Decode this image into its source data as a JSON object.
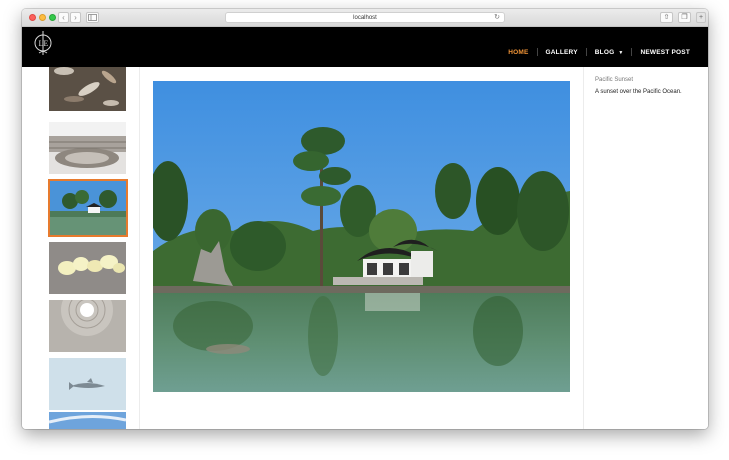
{
  "browser": {
    "url": "localhost",
    "back_icon": "chevron-left-icon",
    "forward_icon": "chevron-right-icon",
    "reload_icon": "reload-icon"
  },
  "site": {
    "logo_name": "monogram-logo",
    "nav": [
      {
        "label": "HOME",
        "active": true
      },
      {
        "label": "GALLERY",
        "active": false
      },
      {
        "label": "BLOG",
        "active": false,
        "dropdown": true
      },
      {
        "label": "NEWEST POST",
        "active": false
      }
    ],
    "accent_color": "#f29537"
  },
  "gallery": {
    "thumbnails": [
      {
        "subject": "koi fish pond",
        "selected": false
      },
      {
        "subject": "colosseum interior",
        "selected": false
      },
      {
        "subject": "japanese garden lake",
        "selected": true
      },
      {
        "subject": "yellow orchids",
        "selected": false
      },
      {
        "subject": "pantheon dome oculus",
        "selected": false
      },
      {
        "subject": "shark in water",
        "selected": false
      },
      {
        "subject": "blue sky",
        "selected": false
      }
    ],
    "selected_color": "#e77b2e"
  },
  "caption": {
    "title": "Pacific Sunset",
    "description": "A sunset over the Pacific Ocean."
  }
}
